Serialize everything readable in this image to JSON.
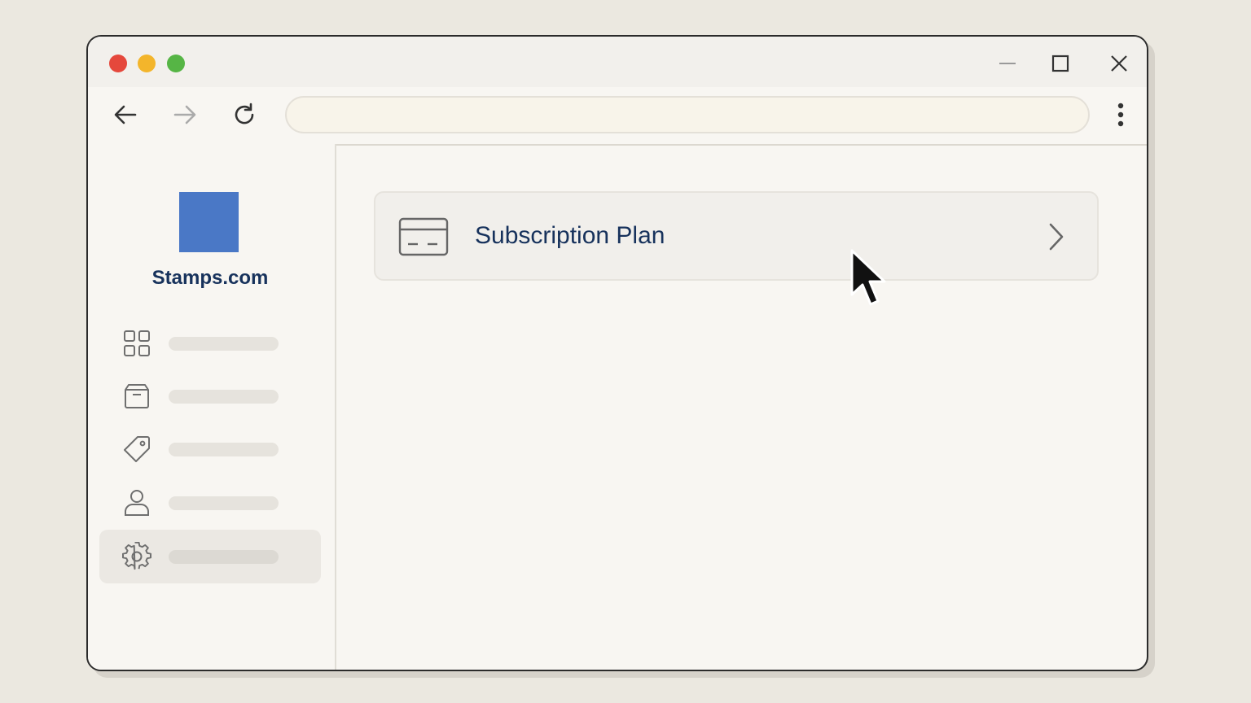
{
  "window": {
    "traffic_lights": [
      "close",
      "minimize",
      "zoom"
    ],
    "controls": [
      "minimize-icon",
      "maximize-icon",
      "close-icon"
    ]
  },
  "toolbar": {
    "address_value": "",
    "icons": [
      "back-arrow-icon",
      "forward-arrow-icon",
      "reload-icon",
      "more-vertical-icon"
    ]
  },
  "sidebar": {
    "brand": "Stamps.com",
    "brand_color": "#4a78c6",
    "items": [
      {
        "icon": "dashboard-grid-icon",
        "label": ""
      },
      {
        "icon": "package-box-icon",
        "label": ""
      },
      {
        "icon": "tag-icon",
        "label": ""
      },
      {
        "icon": "user-icon",
        "label": ""
      },
      {
        "icon": "gear-icon",
        "label": "",
        "active": true
      }
    ]
  },
  "main": {
    "card": {
      "icon": "credit-card-icon",
      "label": "Subscription Plan",
      "trailing_icon": "chevron-right-icon"
    }
  },
  "colors": {
    "text_primary": "#17325c",
    "close": "#e5483c",
    "minimize": "#f3b52b",
    "zoom": "#56b545"
  }
}
